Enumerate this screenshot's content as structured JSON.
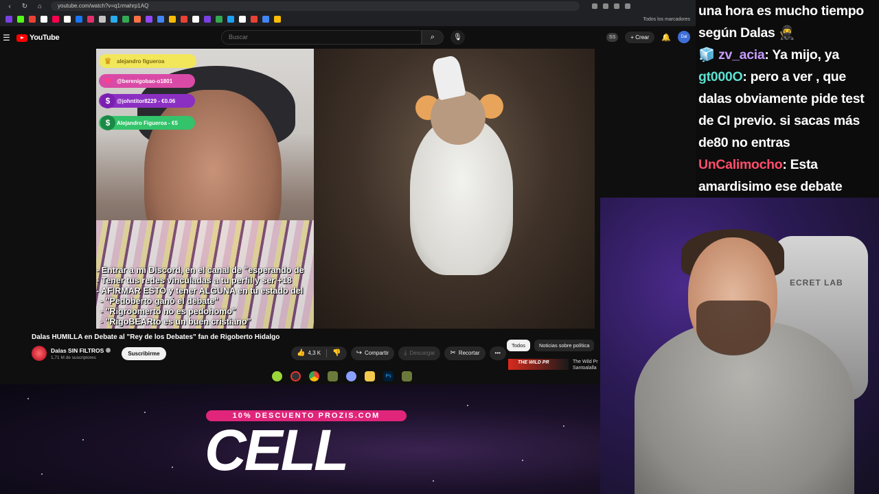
{
  "browser": {
    "url": "youtube.com/watch?v=q1rmahrp1AQ",
    "bookmarks_label": "Todos los marcadores"
  },
  "youtube": {
    "logo_text": "YouTube",
    "search_placeholder": "Buscar",
    "ss_badge": "SS",
    "create_label": "Crear",
    "avatar_text": "Dal"
  },
  "video_overlay": {
    "donations": [
      {
        "name": "alejandro figueroa",
        "color": "#f2e75a",
        "text_color": "#7a6a10",
        "icon": "crown-icon",
        "glyph": "♛"
      },
      {
        "name": "@berenigobao-o1801",
        "color": "#d94aa6",
        "text_color": "#ffffff",
        "icon": "heart-icon",
        "glyph": "♥"
      },
      {
        "name": "@johntitor8229 - €0.06",
        "color": "#8b2fc2",
        "text_color": "#ffffff",
        "icon": "coin-icon",
        "glyph": "$"
      },
      {
        "name": "Alejandro Figueroa - €5",
        "color": "#33c36a",
        "text_color": "#ffffff",
        "icon": "money-icon",
        "glyph": "$"
      }
    ],
    "lines": [
      "- Entrar a mi Discord, en el canal de \"esperando de",
      "- Tener tus redes vinculadas a tu perfil y ser +18",
      "- AFIRMAR ESTO y tener ALGUNA en tu estado del",
      "  - \"Pedoberto ganó el debate\"",
      "  - \"Rigroomerto no es pedohomo\"",
      "  - \"RigoBEARto es un buen cristiano\""
    ]
  },
  "video": {
    "title": "Dalas HUMILLA en Debate al \"Rey de los Debates\" fan de Rigoberto Hidalgo",
    "channel_name": "Dalas SIN FILTROS",
    "subscribers": "1,71 M de suscriptores",
    "subscribe_label": "Suscribirme",
    "likes": "4,3 K",
    "share_label": "Compartir",
    "download_label": "Descargar",
    "clip_label": "Recortar",
    "more_label": "•••"
  },
  "chips": [
    "Todos",
    "Noticias sobre política"
  ],
  "recommended": {
    "thumb_text": "THE WILD PR",
    "title": "The Wild Pr Santoalalla"
  },
  "chat": [
    {
      "user": "",
      "user_color": "#ffffff",
      "text": "una hora es mucho tiempo"
    },
    {
      "user": "",
      "user_color": "#ffffff",
      "text": "según Dalas 🥷"
    },
    {
      "user": "zv_acia",
      "user_color": "#c89cff",
      "text": ": Ya mijo, ya",
      "badge": "🧊"
    },
    {
      "user": "gt000O",
      "user_color": "#5ce0d0",
      "text": ": pero a ver , que"
    },
    {
      "user": "",
      "user_color": "#ffffff",
      "text": "dalas obviamente pide test"
    },
    {
      "user": "",
      "user_color": "#ffffff",
      "text": "de CI previo. si sacas más"
    },
    {
      "user": "",
      "user_color": "#ffffff",
      "text": "de80 no entras"
    },
    {
      "user": "UnCalimocho",
      "user_color": "#ff4d6a",
      "text": ": Esta"
    },
    {
      "user": "",
      "user_color": "#ffffff",
      "text": "amardisimo ese debate"
    }
  ],
  "webcam": {
    "chair_brand": "ECRET LAB"
  },
  "ad": {
    "tag": "10% DESCUENTO PROZIS.COM",
    "big": "CELL"
  }
}
